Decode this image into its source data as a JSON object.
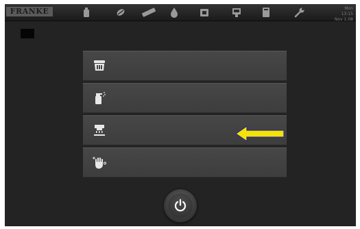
{
  "topbar": {
    "logo_text": "FRANKE",
    "icons": [
      "bottle-icon",
      "bean-icon",
      "tablet-icon",
      "drop-icon",
      "grinder-icon",
      "machine-icon",
      "card-icon",
      "wrench-icon"
    ],
    "datetime_line1": "Mon 13:15",
    "datetime_line2": "Nov 1.08"
  },
  "menu": {
    "items": [
      {
        "name": "menu-item-rinse",
        "icon": "rinse-icon"
      },
      {
        "name": "menu-item-clean",
        "icon": "spray-bottle-icon"
      },
      {
        "name": "menu-item-milk-system",
        "icon": "brew-unit-icon"
      },
      {
        "name": "menu-item-hand-clean",
        "icon": "hand-clean-icon"
      }
    ]
  },
  "annotation": {
    "arrow_color": "#f5e20a",
    "arrow_outline": "#2b2b8a",
    "points_to_item": 3
  },
  "colors": {
    "background": "#232323",
    "menu_item": "#444444",
    "icon": "#e8e8e8"
  },
  "power_button": {
    "icon": "power-icon"
  }
}
